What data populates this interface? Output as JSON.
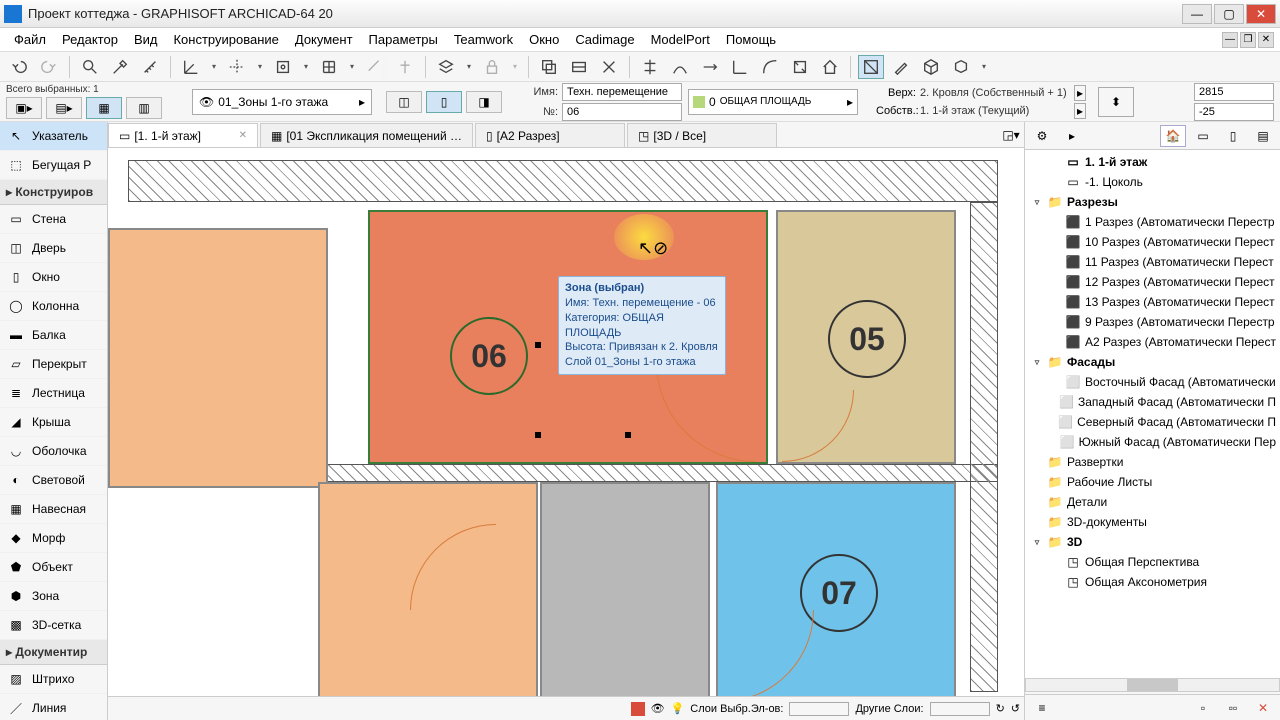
{
  "title": "Проект коттеджа - GRAPHISOFT ARCHICAD-64 20",
  "menu": [
    "Файл",
    "Редактор",
    "Вид",
    "Конструирование",
    "Документ",
    "Параметры",
    "Teamwork",
    "Окно",
    "Cadimage",
    "ModelPort",
    "Помощь"
  ],
  "selinfo": {
    "label": "Всего выбранных: 1"
  },
  "layer": "01_Зоны 1-го этажа",
  "props": {
    "name_label": "Имя:",
    "name": "Техн. перемещение",
    "no_label": "№:",
    "no": "06"
  },
  "category": {
    "num": "0",
    "name": "ОБЩАЯ ПЛОЩАДЬ"
  },
  "floors": {
    "up_label": "Верх:",
    "up": "2. Кровля (Собственный + 1)",
    "own_label": "Собств.:",
    "own": "1. 1-й этаж (Текущий)"
  },
  "coords": {
    "x": "2815",
    "y": "-25"
  },
  "tabs": [
    {
      "label": "[1. 1-й этаж]",
      "active": true,
      "close": true
    },
    {
      "label": "[01 Экспликация помещений …"
    },
    {
      "label": "[А2 Разрез]"
    },
    {
      "label": "[3D / Все]"
    }
  ],
  "toolgroups": [
    {
      "type": "item",
      "label": "Указатель",
      "icon": "arrow",
      "sel": true
    },
    {
      "type": "item",
      "label": "Бегущая Р",
      "icon": "marquee"
    },
    {
      "type": "group",
      "label": "Конструиров"
    },
    {
      "type": "item",
      "label": "Стена",
      "icon": "wall"
    },
    {
      "type": "item",
      "label": "Дверь",
      "icon": "door"
    },
    {
      "type": "item",
      "label": "Окно",
      "icon": "window"
    },
    {
      "type": "item",
      "label": "Колонна",
      "icon": "column"
    },
    {
      "type": "item",
      "label": "Балка",
      "icon": "beam"
    },
    {
      "type": "item",
      "label": "Перекрыт",
      "icon": "slab"
    },
    {
      "type": "item",
      "label": "Лестница",
      "icon": "stair"
    },
    {
      "type": "item",
      "label": "Крыша",
      "icon": "roof"
    },
    {
      "type": "item",
      "label": "Оболочка",
      "icon": "shell"
    },
    {
      "type": "item",
      "label": "Световой",
      "icon": "skylight"
    },
    {
      "type": "item",
      "label": "Навесная",
      "icon": "curtain"
    },
    {
      "type": "item",
      "label": "Морф",
      "icon": "morph"
    },
    {
      "type": "item",
      "label": "Объект",
      "icon": "object"
    },
    {
      "type": "item",
      "label": "Зона",
      "icon": "zone"
    },
    {
      "type": "item",
      "label": "3D-сетка",
      "icon": "mesh"
    },
    {
      "type": "group",
      "label": "Документир"
    },
    {
      "type": "item",
      "label": "Штрихо",
      "icon": "fill"
    },
    {
      "type": "item",
      "label": "Линия",
      "icon": "line"
    }
  ],
  "tooltip": {
    "l1": "Зона (выбран)",
    "l2": "Имя: Техн. перемещение - 06",
    "l3": "Категория: ОБЩАЯ ПЛОЩАДЬ",
    "l4": "Высота: Привязан к 2. Кровля",
    "l5": "Слой 01_Зоны 1-го этажа"
  },
  "zones": {
    "z05": "05",
    "z06": "06",
    "z07": "07"
  },
  "tree": [
    {
      "d": 1,
      "exp": "",
      "icon": "floor",
      "label": "1. 1-й этаж",
      "hdr": true
    },
    {
      "d": 1,
      "exp": "",
      "icon": "floor",
      "label": "-1. Цоколь"
    },
    {
      "d": 0,
      "exp": "▿",
      "icon": "folder",
      "label": "Разрезы",
      "hdr": true
    },
    {
      "d": 1,
      "exp": "",
      "icon": "sect",
      "label": "1 Разрез (Автоматически Перестр"
    },
    {
      "d": 1,
      "exp": "",
      "icon": "sect",
      "label": "10 Разрез (Автоматически Перест"
    },
    {
      "d": 1,
      "exp": "",
      "icon": "sect",
      "label": "11 Разрез (Автоматически Перест"
    },
    {
      "d": 1,
      "exp": "",
      "icon": "sect",
      "label": "12 Разрез (Автоматически Перест"
    },
    {
      "d": 1,
      "exp": "",
      "icon": "sect",
      "label": "13 Разрез (Автоматически Перест"
    },
    {
      "d": 1,
      "exp": "",
      "icon": "sect",
      "label": "9 Разрез (Автоматически Перестр"
    },
    {
      "d": 1,
      "exp": "",
      "icon": "sect",
      "label": "А2 Разрез (Автоматически Перест"
    },
    {
      "d": 0,
      "exp": "▿",
      "icon": "folder",
      "label": "Фасады",
      "hdr": true
    },
    {
      "d": 1,
      "exp": "",
      "icon": "elev",
      "label": "Восточный Фасад (Автоматически"
    },
    {
      "d": 1,
      "exp": "",
      "icon": "elev",
      "label": "Западный Фасад (Автоматически П"
    },
    {
      "d": 1,
      "exp": "",
      "icon": "elev",
      "label": "Северный Фасад (Автоматически П"
    },
    {
      "d": 1,
      "exp": "",
      "icon": "elev",
      "label": "Южный Фасад (Автоматически Пер"
    },
    {
      "d": 0,
      "exp": "",
      "icon": "folder",
      "label": "Развертки"
    },
    {
      "d": 0,
      "exp": "",
      "icon": "folder",
      "label": "Рабочие Листы"
    },
    {
      "d": 0,
      "exp": "",
      "icon": "folder",
      "label": "Детали"
    },
    {
      "d": 0,
      "exp": "",
      "icon": "folder",
      "label": "3D-документы"
    },
    {
      "d": 0,
      "exp": "▿",
      "icon": "folder",
      "label": "3D",
      "hdr": true
    },
    {
      "d": 1,
      "exp": "",
      "icon": "3d",
      "label": "Общая Перспектива"
    },
    {
      "d": 1,
      "exp": "",
      "icon": "3d",
      "label": "Общая Аксонометрия"
    }
  ],
  "bottom": {
    "layers": "Слои Выбр.Эл-ов:",
    "other": "Другие Слои:"
  }
}
